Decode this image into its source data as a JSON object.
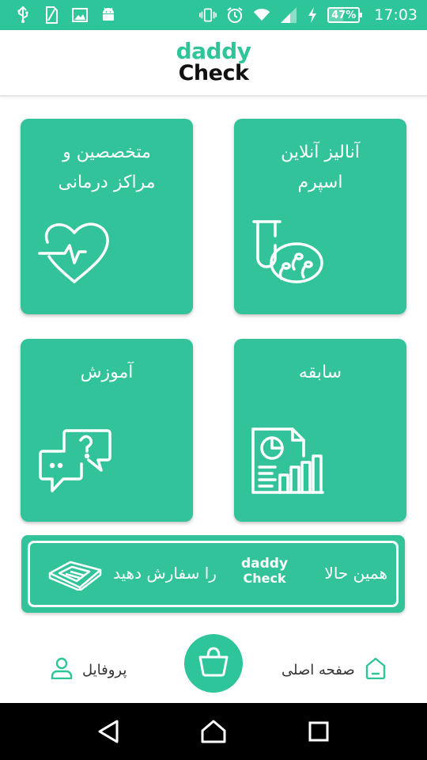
{
  "status_bar": {
    "battery": "47%",
    "battery_level": 0.47,
    "time": "17:03",
    "icons": [
      "usb-icon",
      "sim-icon",
      "image-icon",
      "android-icon",
      "vibrate-icon",
      "alarm-icon",
      "wifi-icon",
      "signal-icon",
      "charging-icon",
      "battery-icon"
    ]
  },
  "header": {
    "logo_line1": "daddy",
    "logo_line2": "Check"
  },
  "tiles": [
    {
      "id": "sperm-analysis",
      "title_line1": "آنالیز آنلاین",
      "title_line2": "اسپرم",
      "icon": "test-tube-sperm-icon"
    },
    {
      "id": "specialists",
      "title_line1": "متخصصین و",
      "title_line2": "مراکز درمانی",
      "icon": "heart-pulse-icon"
    },
    {
      "id": "history",
      "title_line1": "سابقه",
      "title_line2": "",
      "icon": "report-chart-icon"
    },
    {
      "id": "education",
      "title_line1": "آموزش",
      "title_line2": "",
      "icon": "chat-question-icon"
    }
  ],
  "order_banner": {
    "text_before": "همین حالا",
    "logo_line1": "daddy",
    "logo_line2": "Check",
    "text_after": "را سفارش دهید",
    "icon": "kit-box-icon"
  },
  "bottom_nav": {
    "home_label": "صفحه اصلی",
    "profile_label": "پروفایل",
    "cart_icon": "shopping-basket-icon"
  },
  "colors": {
    "primary": "#2fc59a",
    "tile": "#33c39a",
    "text_dark": "#333333"
  }
}
